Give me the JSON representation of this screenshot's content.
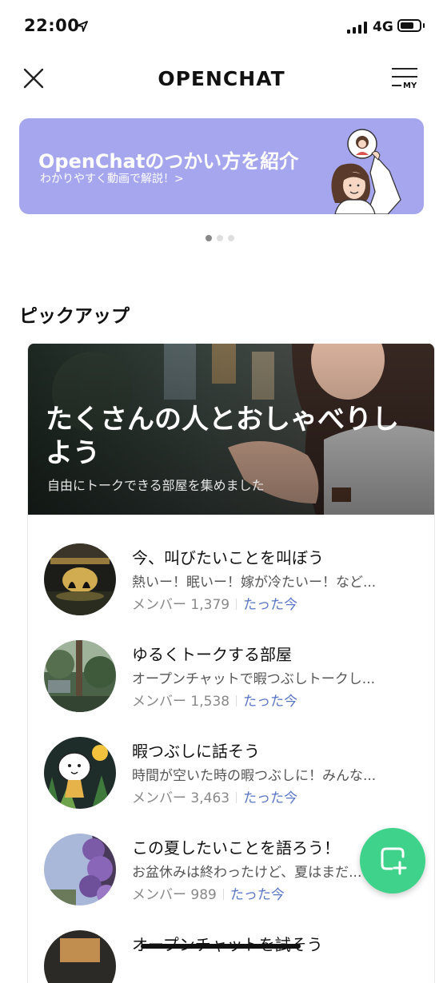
{
  "status_bar": {
    "time": "22:00",
    "network": "4G"
  },
  "nav": {
    "title": "OPENCHAT",
    "my_label": "MY"
  },
  "banner": {
    "title": "OpenChatのつかい方を紹介",
    "subtitle": "わかりやすく動画で解説！>",
    "background": "#a6a6ef"
  },
  "carousel": {
    "pages": 3,
    "active": 1
  },
  "section": {
    "title": "ピックアップ"
  },
  "hero": {
    "title": "たくさんの人とおしゃべりしよう",
    "subtitle": "自由にトークできる部屋を集めました"
  },
  "rooms": [
    {
      "name": "今、叫びたいことを叫ぼう",
      "description": "熱いー！眠いー！嫁が冷たいー！など...",
      "members": "メンバー 1,379",
      "time": "たった今"
    },
    {
      "name": "ゆるくトークする部屋",
      "description": "オープンチャットで暇つぶしトークし...",
      "members": "メンバー 1,538",
      "time": "たった今"
    },
    {
      "name": "暇つぶしに話そう",
      "description": "時間が空いた時の暇つぶしに！みんな...",
      "members": "メンバー 3,463",
      "time": "たった今"
    },
    {
      "name": "この夏したいことを語ろう！",
      "description": "お盆休みは終わったけど、夏はまだ...",
      "members": "メンバー 989",
      "time": "たった今"
    },
    {
      "name": "オープンチャットを試そう",
      "description": "",
      "members": "",
      "time": ""
    }
  ],
  "colors": {
    "accent_green": "#3ed28a",
    "link_blue": "#5976c4"
  },
  "icons": [
    "location-arrow-icon",
    "signal-icon",
    "battery-icon",
    "close-icon",
    "menu-my-icon",
    "create-chat-icon"
  ]
}
